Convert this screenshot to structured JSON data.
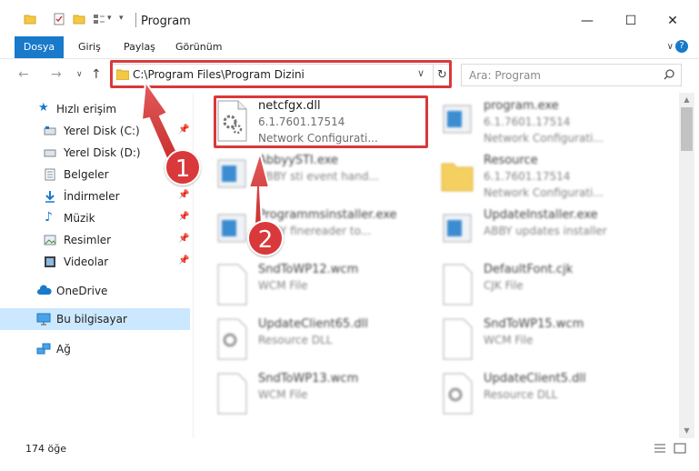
{
  "window": {
    "title": "Program",
    "controls": {
      "minimize": "—",
      "maximize": "☐",
      "close": "✕"
    }
  },
  "ribbon": {
    "tabs": [
      "Dosya",
      "Giriş",
      "Paylaş",
      "Görünüm"
    ]
  },
  "address_bar": {
    "path": "C:\\Program Files\\Program Dizini",
    "search_placeholder": "Ara: Program"
  },
  "sidebar": {
    "quick_access": "Hızlı erişim",
    "items": [
      {
        "label": "Yerel Disk (C:)",
        "icon": "drive-icon",
        "pinned": true
      },
      {
        "label": "Yerel Disk (D:)",
        "icon": "drive-icon",
        "pinned": false
      },
      {
        "label": "Belgeler",
        "icon": "documents-icon",
        "pinned": true
      },
      {
        "label": "İndirmeler",
        "icon": "download-icon",
        "pinned": true
      },
      {
        "label": "Müzik",
        "icon": "music-icon",
        "pinned": true
      },
      {
        "label": "Resimler",
        "icon": "pictures-icon",
        "pinned": true
      },
      {
        "label": "Videolar",
        "icon": "videos-icon",
        "pinned": true
      }
    ],
    "onedrive": "OneDrive",
    "this_pc": "Bu bilgisayar",
    "network": "Ağ"
  },
  "files": {
    "highlighted": {
      "name": "netcfgx.dll",
      "version": "6.1.7601.17514",
      "description": "Network Configurati..."
    },
    "others": [
      {
        "name": "program.exe",
        "line2": "6.1.7601.17514",
        "line3": "Network Configurati...",
        "type": "exe"
      },
      {
        "name": "AbbyySTI.exe",
        "line2": "ABBY sti event hand...",
        "line3": "",
        "type": "exe"
      },
      {
        "name": "Resource",
        "line2": "6.1.7601.17514",
        "line3": "Network Configurati...",
        "type": "folder"
      },
      {
        "name": "Programmsinstaller.exe",
        "line2": "ABBY finereader to...",
        "line3": "",
        "type": "exe"
      },
      {
        "name": "UpdateInstaller.exe",
        "line2": "ABBY updates installer",
        "line3": "",
        "type": "exe"
      },
      {
        "name": "SndToWP12.wcm",
        "line2": "WCM File",
        "line3": "",
        "type": "file"
      },
      {
        "name": "DefaultFont.cjk",
        "line2": "CJK File",
        "line3": "",
        "type": "file"
      },
      {
        "name": "UpdateClient65.dll",
        "line2": "Resource DLL",
        "line3": "",
        "type": "dll"
      },
      {
        "name": "SndToWP15.wcm",
        "line2": "WCM File",
        "line3": "",
        "type": "file"
      },
      {
        "name": "SndToWP13.wcm",
        "line2": "WCM File",
        "line3": "",
        "type": "file"
      },
      {
        "name": "UpdateClient5.dll",
        "line2": "Resource DLL",
        "line3": "",
        "type": "dll"
      }
    ]
  },
  "status": {
    "item_count": "174 öğe"
  },
  "callouts": {
    "step1": "1",
    "step2": "2"
  },
  "colors": {
    "accent": "#1979ca",
    "highlight": "#d9393b",
    "selected": "#cce8ff"
  }
}
